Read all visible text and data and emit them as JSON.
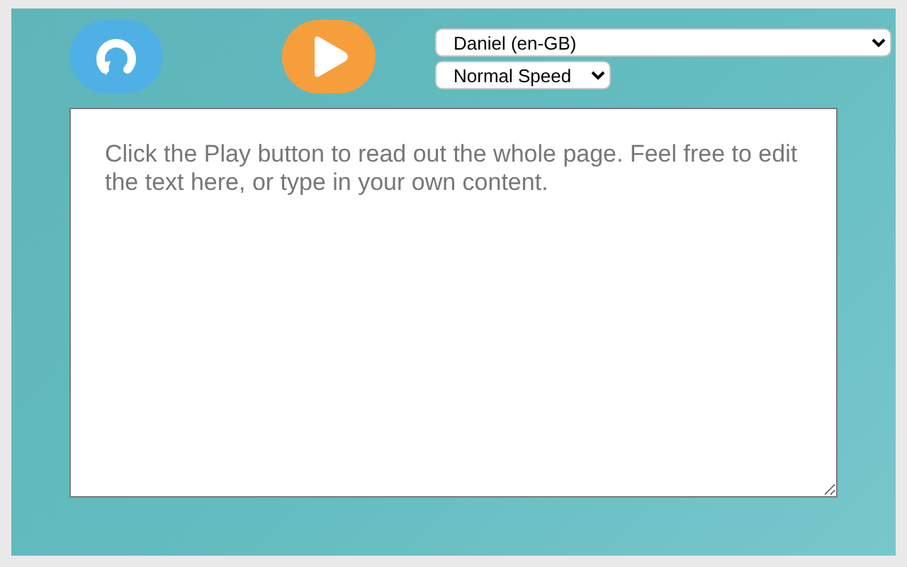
{
  "toolbar": {
    "voice_select": {
      "value": "Daniel (en-GB)"
    },
    "speed_select": {
      "value": "Normal Speed"
    }
  },
  "editor": {
    "placeholder": "Click the Play button to read out the whole page. Feel free to edit the text here, or type in your own content."
  }
}
